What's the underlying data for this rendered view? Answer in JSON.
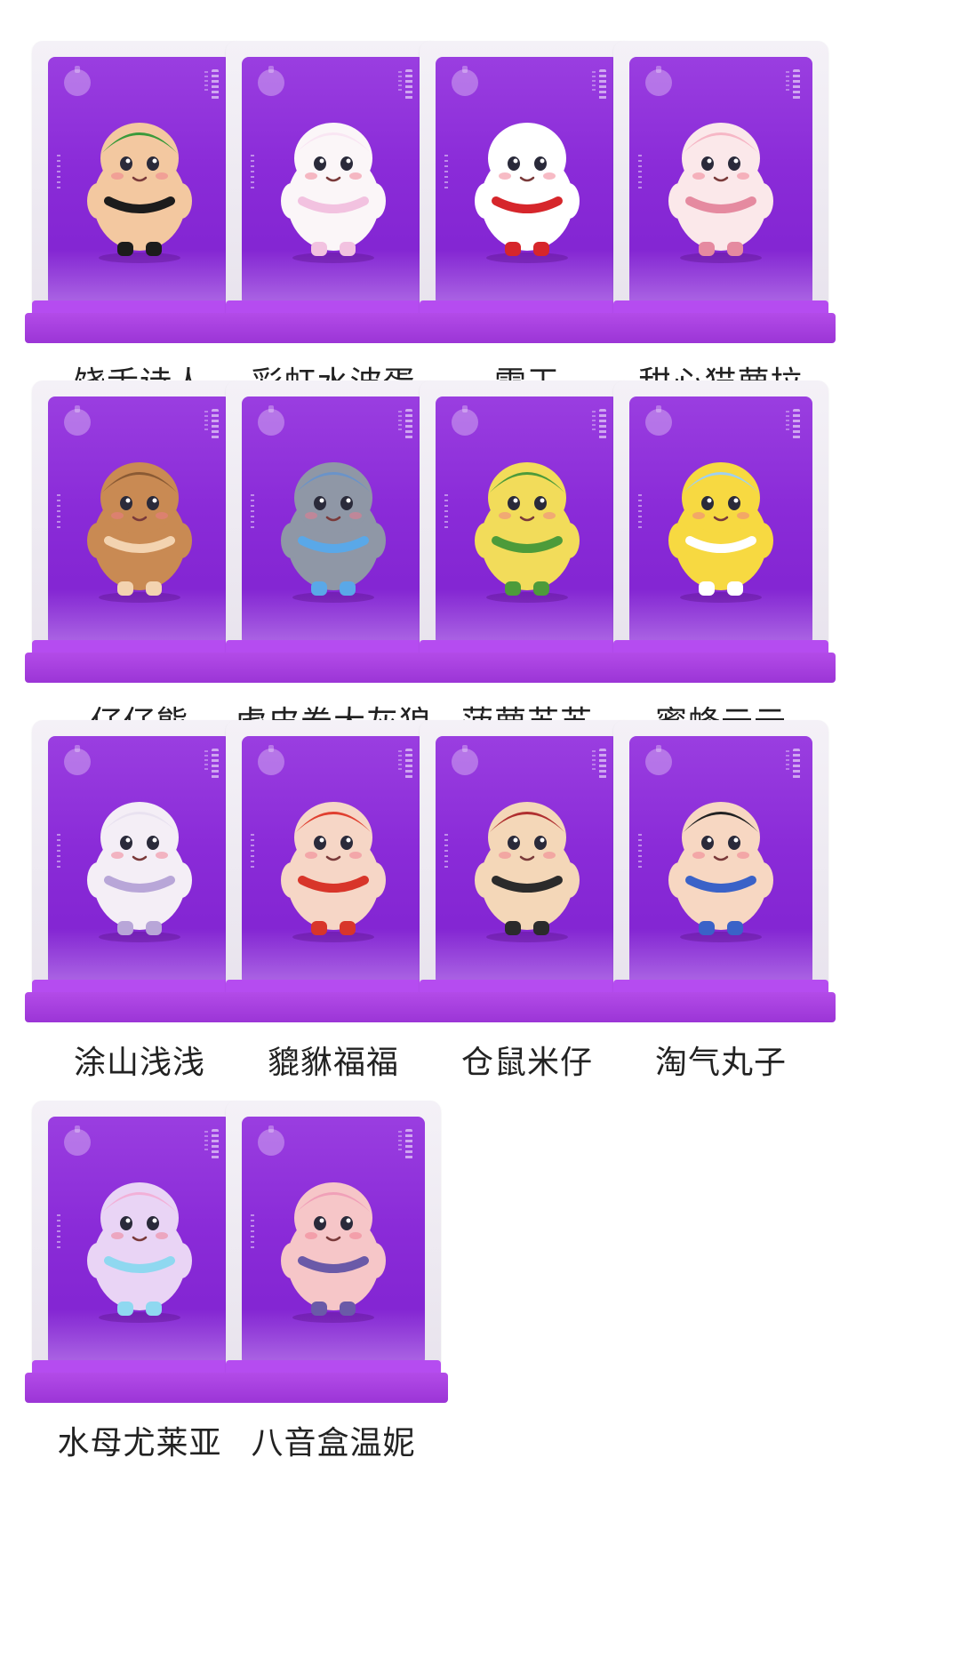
{
  "items": [
    {
      "name": "饶舌诗人",
      "body": "#f3c8a0",
      "accent": "#1c1c1c",
      "hat": "#3a9a3a"
    },
    {
      "name": "彩虹水波蛋",
      "body": "#fbf6f8",
      "accent": "#f2c2e0",
      "hat": "#f9e6f3"
    },
    {
      "name": "雪王",
      "body": "#ffffff",
      "accent": "#d6262b",
      "hat": "#ffffff"
    },
    {
      "name": "甜心猫萝拉",
      "body": "#fbe8ea",
      "accent": "#e58aa0",
      "hat": "#f6b7c6"
    },
    {
      "name": "仔仔熊",
      "body": "#c98a53",
      "accent": "#f3d3b0",
      "hat": "#8a5a34"
    },
    {
      "name": "虎皮卷大灰狼",
      "body": "#8f97a6",
      "accent": "#5aa8e8",
      "hat": "#6a93c9"
    },
    {
      "name": "菠萝苏苏",
      "body": "#f2dc5a",
      "accent": "#4d9b3a",
      "hat": "#4d9b3a"
    },
    {
      "name": "蜜蜂云云",
      "body": "#f7d941",
      "accent": "#ffffff",
      "hat": "#9fd0f0"
    },
    {
      "name": "涂山浅浅",
      "body": "#f4eef6",
      "accent": "#b8a6d8",
      "hat": "#e9e2f0"
    },
    {
      "name": "貔貅福福",
      "body": "#f6d6c6",
      "accent": "#d8352a",
      "hat": "#e04030"
    },
    {
      "name": "仓鼠米仔",
      "body": "#f4d7b8",
      "accent": "#2b2b2b",
      "hat": "#b03030"
    },
    {
      "name": "淘气丸子",
      "body": "#f7d7c2",
      "accent": "#3a62c8",
      "hat": "#222222"
    },
    {
      "name": "水母尤莱亚",
      "body": "#e9d4f5",
      "accent": "#8fd8f0",
      "hat": "#f2b0d8"
    },
    {
      "name": "八音盒温妮",
      "body": "#f6c6c8",
      "accent": "#6a5aa8",
      "hat": "#f0a0b8"
    }
  ],
  "colors": {
    "panel": "#8a2bd8",
    "base": "#a640e2",
    "frame": "#ece7f0",
    "label": "#222222"
  }
}
